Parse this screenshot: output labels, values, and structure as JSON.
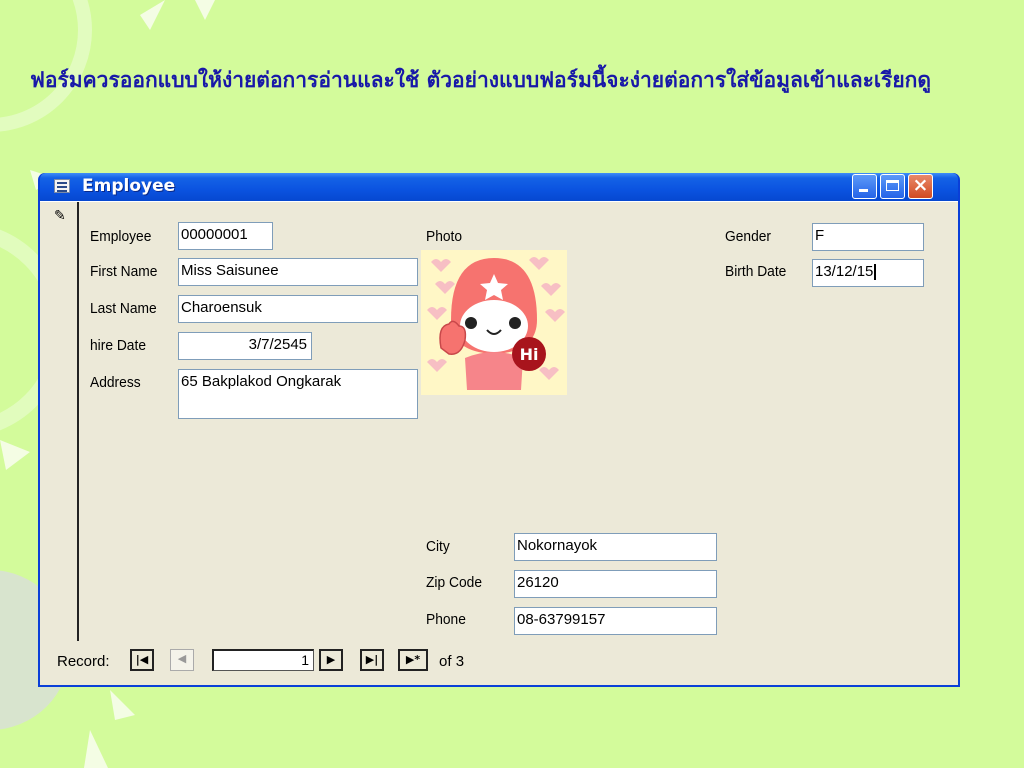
{
  "slide": {
    "title": "ฟอร์มควรออกแบบให้ง่ายต่อการอ่านและใช้ ตัวอย่างแบบฟอร์มนี้จะง่ายต่อการใส่ข้อมูลเข้าและเรียกดู"
  },
  "window": {
    "title": "Employee",
    "icon": "form-icon",
    "controls": [
      "minimize-icon",
      "maximize-icon",
      "close-icon"
    ]
  },
  "form": {
    "employee": {
      "label": "Employee",
      "value": "00000001"
    },
    "first_name": {
      "label": "First Name",
      "value": "Miss Saisunee"
    },
    "last_name": {
      "label": "Last Name",
      "value": "Charoensuk"
    },
    "hire_date": {
      "label": "hire Date",
      "value": "3/7/2545"
    },
    "address": {
      "label": "Address",
      "value": "65 Bakplakod Ongkarak"
    },
    "photo": {
      "label": "Photo"
    },
    "gender": {
      "label": "Gender",
      "value": "F"
    },
    "birth_date": {
      "label": "Birth Date",
      "value": "13/12/15"
    },
    "city": {
      "label": "City",
      "value": "Nokornayok"
    },
    "zip_code": {
      "label": "Zip Code",
      "value": "26120"
    },
    "phone": {
      "label": "Phone",
      "value": "08-63799157"
    }
  },
  "navigation": {
    "record_label": "Record:",
    "current": "1",
    "of_label": "of",
    "total": "3",
    "first_symbol": "|◀",
    "prev_symbol": "◀",
    "next_symbol": "▶",
    "last_symbol": "▶|",
    "new_symbol": "▶*"
  },
  "colors": {
    "background": "#d3fb9b",
    "title_text": "#1818a8",
    "titlebar": "#0b53e0"
  }
}
